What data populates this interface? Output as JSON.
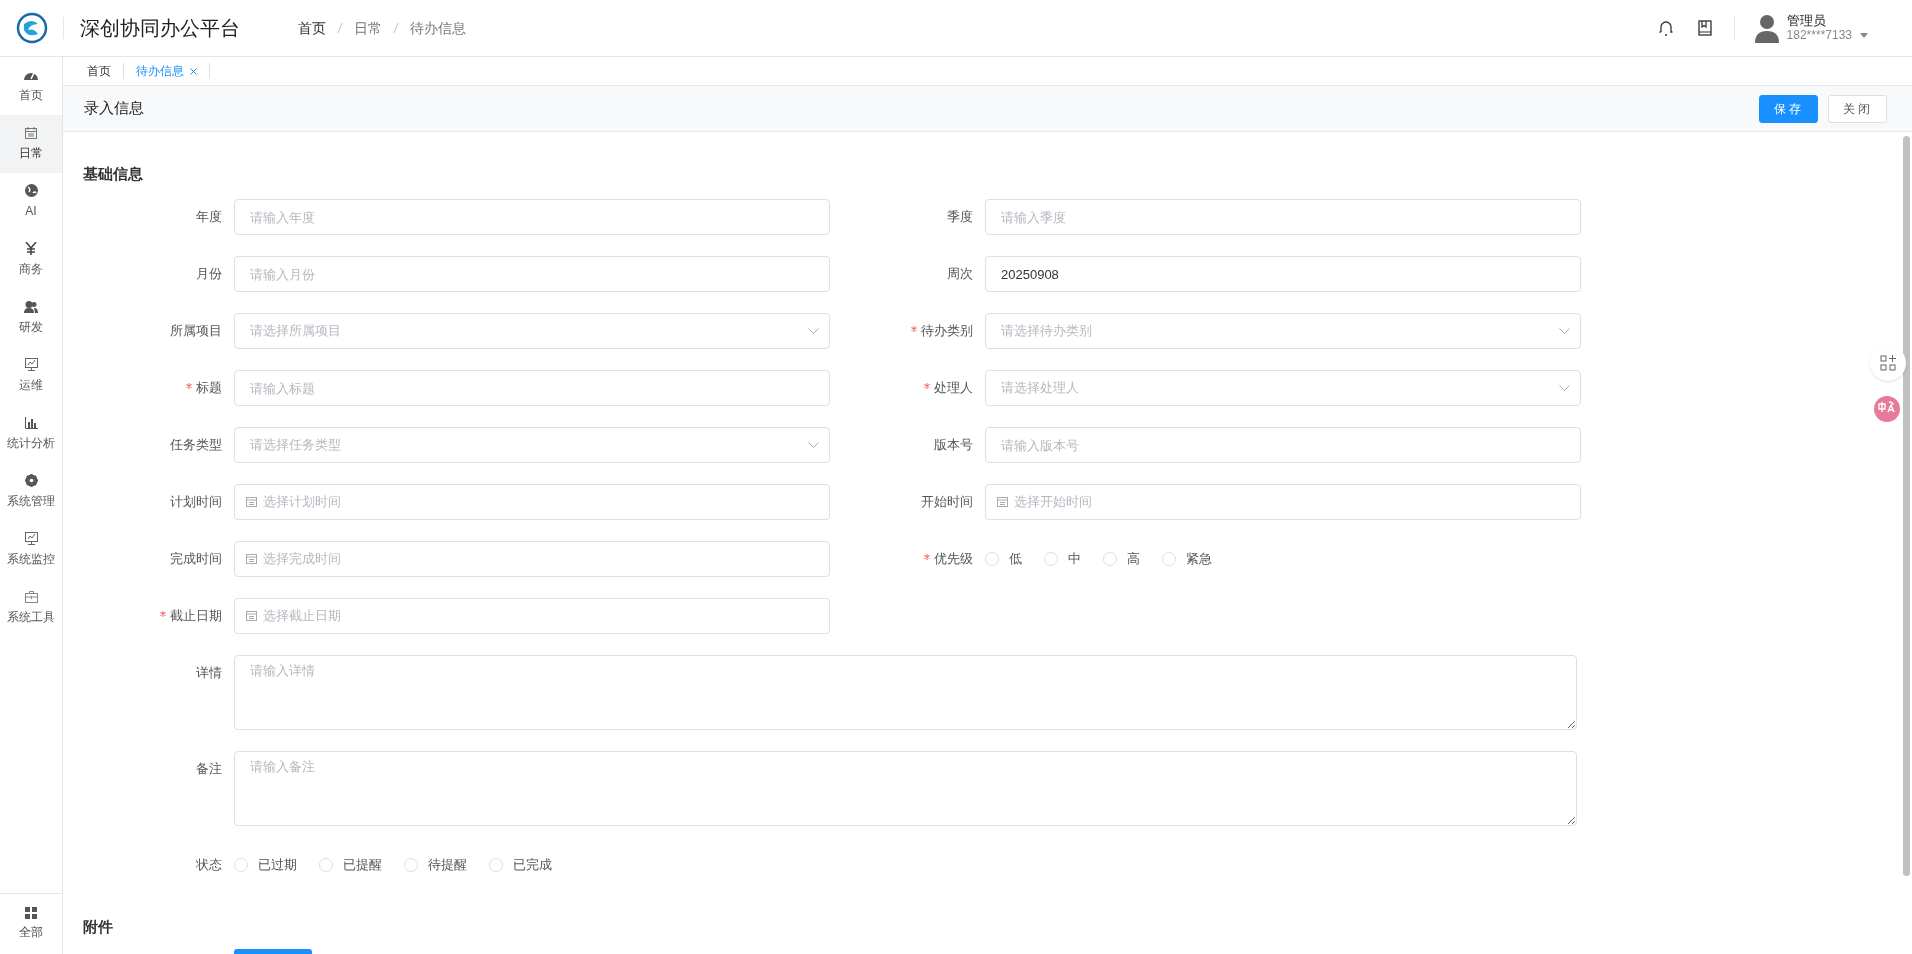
{
  "header": {
    "title": "深创协同办公平台",
    "breadcrumb": [
      {
        "label": "首页",
        "link": true
      },
      {
        "label": "日常",
        "link": false
      },
      {
        "label": "待办信息",
        "link": false
      }
    ],
    "user": {
      "name": "管理员",
      "phone": "182****7133"
    }
  },
  "sidebar": {
    "items": [
      {
        "label": "首页",
        "selected": false
      },
      {
        "label": "日常",
        "selected": true
      },
      {
        "label": "AI",
        "selected": false
      },
      {
        "label": "商务",
        "selected": false
      },
      {
        "label": "研发",
        "selected": false
      },
      {
        "label": "运维",
        "selected": false
      },
      {
        "label": "统计分析",
        "selected": false
      },
      {
        "label": "系统管理",
        "selected": false
      },
      {
        "label": "系统监控",
        "selected": false
      },
      {
        "label": "系统工具",
        "selected": false
      }
    ],
    "footer": {
      "label": "全部"
    }
  },
  "tabs": [
    {
      "label": "首页",
      "selected": false,
      "closable": false
    },
    {
      "label": "待办信息",
      "selected": true,
      "closable": true
    }
  ],
  "page": {
    "title": "录入信息",
    "buttons": [
      {
        "label": "保存",
        "kind": "primary"
      },
      {
        "label": "关闭",
        "kind": "default"
      }
    ]
  },
  "form": {
    "section": "基础信息",
    "fields": [
      {
        "label": "年度",
        "kind": "input",
        "required": false,
        "placeholder": "请输入年度"
      },
      {
        "label": "季度",
        "kind": "input",
        "required": false,
        "placeholder": "请输入季度"
      },
      {
        "label": "月份",
        "kind": "input",
        "required": false,
        "placeholder": "请输入月份"
      },
      {
        "label": "周次",
        "kind": "input",
        "required": false,
        "value": "20250908"
      },
      {
        "label": "所属项目",
        "kind": "select",
        "required": false,
        "placeholder": "请选择所属项目"
      },
      {
        "label": "待办类别",
        "kind": "select",
        "required": true,
        "placeholder": "请选择待办类别"
      },
      {
        "label": "标题",
        "kind": "input",
        "required": true,
        "placeholder": "请输入标题"
      },
      {
        "label": "处理人",
        "kind": "select",
        "required": true,
        "placeholder": "请选择处理人"
      },
      {
        "label": "任务类型",
        "kind": "select",
        "required": false,
        "placeholder": "请选择任务类型"
      },
      {
        "label": "版本号",
        "kind": "input",
        "required": false,
        "placeholder": "请输入版本号"
      },
      {
        "label": "计划时间",
        "kind": "date",
        "required": false,
        "placeholder": "选择计划时间"
      },
      {
        "label": "开始时间",
        "kind": "date",
        "required": false,
        "placeholder": "选择开始时间"
      },
      {
        "label": "完成时间",
        "kind": "date",
        "required": false,
        "placeholder": "选择完成时间"
      },
      {
        "label": "优先级",
        "kind": "radio",
        "required": true,
        "options": [
          {
            "label": "低",
            "selected": false
          },
          {
            "label": "中",
            "selected": false
          },
          {
            "label": "高",
            "selected": false
          },
          {
            "label": "紧急",
            "selected": false
          }
        ]
      },
      {
        "label": "截止日期",
        "kind": "date",
        "required": true,
        "placeholder": "选择截止日期"
      },
      {
        "label": "详情",
        "kind": "textarea",
        "required": false,
        "placeholder": "请输入详情"
      },
      {
        "label": "备注",
        "kind": "textarea",
        "required": false,
        "placeholder": "请输入备注"
      },
      {
        "label": "状态",
        "kind": "radio",
        "wide": true,
        "required": false,
        "options": [
          {
            "label": "已过期",
            "selected": false
          },
          {
            "label": "已提醒",
            "selected": false
          },
          {
            "label": "待提醒",
            "selected": false
          },
          {
            "label": "已完成",
            "selected": false
          }
        ]
      }
    ]
  },
  "attachments": {
    "section": "附件"
  }
}
